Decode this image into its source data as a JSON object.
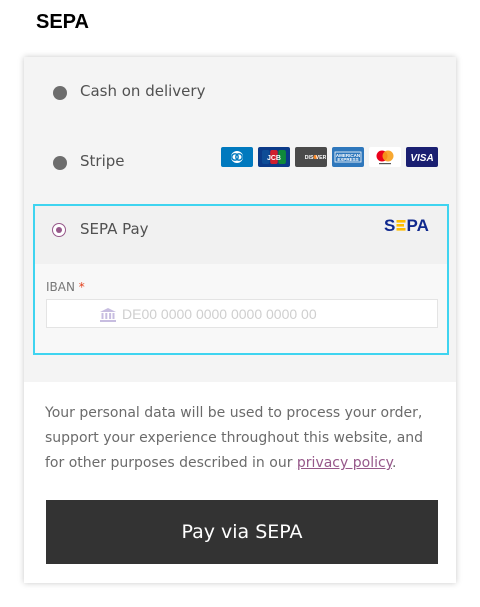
{
  "page": {
    "title": "SEPA"
  },
  "methods": {
    "cash": {
      "label": "Cash on delivery"
    },
    "stripe": {
      "label": "Stripe",
      "card_icons": [
        "diners-club",
        "jcb",
        "discover",
        "american-express",
        "mastercard",
        "visa"
      ]
    },
    "sepa": {
      "label": "SEPA Pay",
      "logo_text": "SEPA",
      "selected": true
    }
  },
  "iban": {
    "label": "IBAN",
    "required_mark": "*",
    "placeholder": "DE00 0000 0000 0000 0000 00",
    "value": ""
  },
  "privacy": {
    "text": "Your personal data will be used to process your order, support your experience throughout this website, and for other purposes described in our ",
    "link": "privacy policy",
    "suffix": "."
  },
  "pay_button": {
    "label": "Pay via SEPA"
  },
  "colors": {
    "accent": "#96588a",
    "focus_border": "#3fd4f0",
    "button_bg": "#333333",
    "sepa_logo_blue": "#10298e",
    "sepa_logo_yellow": "#ffbe00"
  }
}
